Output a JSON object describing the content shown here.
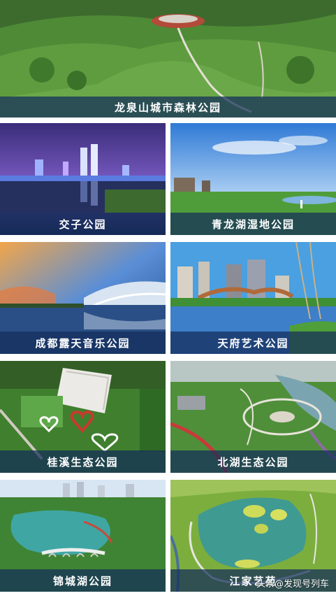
{
  "hero": {
    "caption": "龙泉山城市森林公园"
  },
  "parks": [
    {
      "caption": "交子公园"
    },
    {
      "caption": "青龙湖湿地公园"
    },
    {
      "caption": "成都露天音乐公园"
    },
    {
      "caption": "天府艺术公园"
    },
    {
      "caption": "桂溪生态公园"
    },
    {
      "caption": "北湖生态公园"
    },
    {
      "caption": "锦城湖公园"
    },
    {
      "caption": "江家艺苑"
    }
  ],
  "watermark": {
    "text": "头条@发现号列车",
    "icon": "toutiao-logo-icon"
  }
}
